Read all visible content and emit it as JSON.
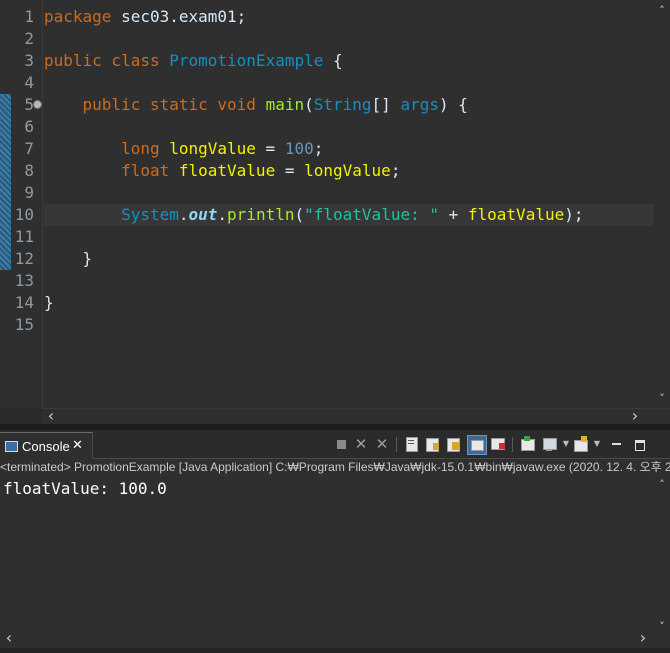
{
  "editor": {
    "line_numbers": [
      "1",
      "2",
      "3",
      "4",
      "5",
      "6",
      "7",
      "8",
      "9",
      "10",
      "11",
      "12",
      "13",
      "14",
      "15"
    ],
    "code": {
      "l1_package": "package",
      "l1_name": " sec03.exam01;",
      "l3_public": "public",
      "l3_class": " class ",
      "l3_classname": "PromotionExample",
      "l3_brace": " {",
      "l5_indent": "    ",
      "l5_public": "public",
      "l5_static": " static",
      "l5_void": " void",
      "l5_main": " main",
      "l5_paren": "(",
      "l5_string": "String",
      "l5_arr": "[] ",
      "l5_args": "args",
      "l5_end": ") {",
      "l7_indent": "        ",
      "l7_long": "long",
      "l7_var": " longValue",
      "l7_eq": " = ",
      "l7_num": "100",
      "l7_semi": ";",
      "l8_indent": "        ",
      "l8_float": "float",
      "l8_var": " floatValue",
      "l8_eq": " = ",
      "l8_ref": "longValue",
      "l8_semi": ";",
      "l10_indent": "        ",
      "l10_system": "System",
      "l10_dot1": ".",
      "l10_out": "out",
      "l10_dot2": ".",
      "l10_println": "println",
      "l10_open": "(",
      "l10_str": "\"floatValue: \"",
      "l10_plus": " + ",
      "l10_ref": "floatValue",
      "l10_close": ");",
      "l12_brace": "    }",
      "l14_brace": "}"
    }
  },
  "console": {
    "tab_label": "Console",
    "close_glyph": "✕",
    "status": "<terminated> PromotionExample [Java Application] C:₩Program Files₩Java₩jdk-15.0.1₩bin₩javaw.exe  (2020. 12. 4. 오후 2",
    "output": "floatValue: 100.0"
  },
  "icons": {
    "left_arrow": "‹",
    "right_arrow": "›",
    "up_arrow": "˄",
    "down_arrow": "˅"
  },
  "colors": {
    "keyword": "#cc6c1d",
    "type": "#1290c3",
    "variable": "#f2f200",
    "string": "#17c6a3",
    "method": "#a7ec21"
  }
}
